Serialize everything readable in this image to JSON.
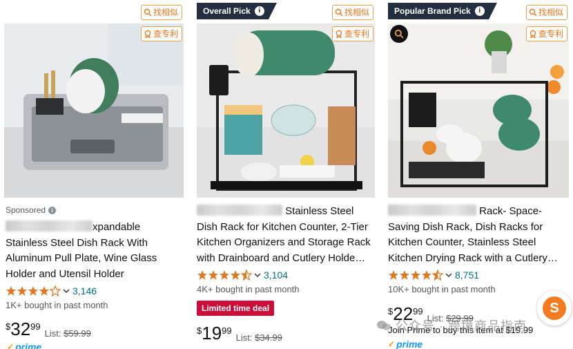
{
  "extension": {
    "find_similar_label": "找相似",
    "check_patent_label": "查专利"
  },
  "products": [
    {
      "badge": "",
      "sponsored": "Sponsored",
      "title_lines": [
        "xpandable",
        "Stainless Steel Dish Rack With",
        "Aluminum Pull Plate, Wine Glass",
        "Holder and Utensil Holder"
      ],
      "rating": 4.0,
      "reviews": "3,146",
      "bought": "1K+ bought in past month",
      "price_symbol": "$",
      "price_whole": "32",
      "price_fraction": "99",
      "list_label": "List:",
      "list_price": "$59.99",
      "prime": "prime"
    },
    {
      "badge": "Overall Pick",
      "title_lines": [
        "Stainless Steel",
        "Dish Rack for Kitchen Counter, 2-Tier",
        "Kitchen Organizers and Storage Rack",
        "with Drainboard and Cutlery Holde…"
      ],
      "rating": 4.5,
      "reviews": "3,104",
      "bought": "4K+ bought in past month",
      "deal": "Limited time deal",
      "price_symbol": "$",
      "price_whole": "19",
      "price_fraction": "99",
      "list_label": "List:",
      "list_price": "$34.99"
    },
    {
      "badge": "Popular Brand Pick",
      "title_lines": [
        "Rack- Space-",
        "Saving Dish Rack, Dish Racks for",
        "Kitchen Counter, Stainless Steel",
        "Kitchen Drying Rack with a Cutlery…"
      ],
      "rating": 4.5,
      "reviews": "8,751",
      "bought": "10K+ bought in past month",
      "price_symbol": "$",
      "price_whole": "22",
      "price_fraction": "99",
      "list_label": "List:",
      "list_price": "$29.99",
      "join_text": "Join Prime to buy this item at $19.99",
      "prime": "prime"
    }
  ],
  "watermark": "公众号 · 跨境商品指南",
  "colors": {
    "badge_bg": "#232f3e",
    "star": "#de7921",
    "link": "#007185",
    "deal_bg": "#cc0c39",
    "extension_orange": "#e8771a"
  }
}
